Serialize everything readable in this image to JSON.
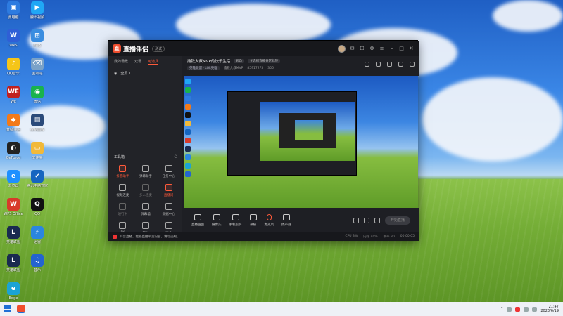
{
  "desktop": {
    "icons": [
      {
        "label": "此电脑",
        "glyph": "▣",
        "color": "#2d7be0"
      },
      {
        "label": "腾讯视频",
        "glyph": "▶",
        "color": "#20a7f5"
      },
      {
        "label": "WPS",
        "glyph": "W",
        "color": "#2f5fd6"
      },
      {
        "label": "网络",
        "glyph": "⊞",
        "color": "#3a8de0"
      },
      {
        "label": "QQ音乐",
        "glyph": "♪",
        "color": "#f5c518"
      },
      {
        "label": "回收站",
        "glyph": "⌫",
        "color": "#7aa2c8"
      },
      {
        "label": "WE",
        "glyph": "WE",
        "color": "#c02020"
      },
      {
        "label": "微信",
        "glyph": "◉",
        "color": "#19b34c"
      },
      {
        "label": "直播伴侣",
        "glyph": "◆",
        "color": "#f27a1a"
      },
      {
        "label": "控制面板",
        "glyph": "▤",
        "color": "#2a4a7a"
      },
      {
        "label": "GeForce",
        "glyph": "◐",
        "color": "#222"
      },
      {
        "label": "文件夹",
        "glyph": "▭",
        "color": "#f1b93a"
      },
      {
        "label": "浏览器",
        "glyph": "e",
        "color": "#1e90ff"
      },
      {
        "label": "腾讯电脑管家",
        "glyph": "✔",
        "color": "#1565c0"
      },
      {
        "label": "WPS Office",
        "glyph": "W",
        "color": "#d83a2a"
      },
      {
        "label": "QQ",
        "glyph": "Q",
        "color": "#111"
      },
      {
        "label": "英雄联盟",
        "glyph": "L",
        "color": "#1a2b50"
      },
      {
        "label": "迅雷",
        "glyph": "⚡",
        "color": "#2b86e0"
      },
      {
        "label": "英雄联盟",
        "glyph": "L",
        "color": "#1a2b50"
      },
      {
        "label": "音乐",
        "glyph": "♫",
        "color": "#2464d0"
      },
      {
        "label": "Edge",
        "glyph": "e",
        "color": "#1ba3d5"
      }
    ]
  },
  "app": {
    "title": "直播伴侣",
    "version": "测试",
    "left_tabs": [
      "我的场景",
      "双场",
      "可道具"
    ],
    "scene_label": "全屏 1",
    "toolbox_label": "工具箱",
    "tools": [
      {
        "label": "抖音助手",
        "state": "hot"
      },
      {
        "label": "弹幕助手",
        "state": ""
      },
      {
        "label": "任务中心",
        "state": ""
      },
      {
        "label": "视频连麦",
        "state": ""
      },
      {
        "label": "多人连麦",
        "state": "dim"
      },
      {
        "label": "直播间",
        "state": "hot"
      },
      {
        "label": "进行中",
        "state": "dim"
      },
      {
        "label": "弹幕墙",
        "state": ""
      },
      {
        "label": "数据中心",
        "state": ""
      },
      {
        "label": "PK",
        "state": ""
      },
      {
        "label": "互动",
        "state": ""
      },
      {
        "label": "更多",
        "state": ""
      }
    ],
    "room": {
      "title": "撸铁大叔MVP的快乐生活",
      "edit_tag": "修改",
      "notice_tag": "#选择直播分区标签",
      "category_tag": "英雄联盟 · LOL英雄",
      "uid_label": "撸铁大叔MVP",
      "uid": "85917275",
      "fans": "356"
    },
    "controls": [
      {
        "label": "直播画面"
      },
      {
        "label": "摄像头"
      },
      {
        "label": "手机投屏"
      },
      {
        "label": "录播"
      },
      {
        "label": "麦克风",
        "kind": "mic"
      },
      {
        "label": "扬声器"
      }
    ],
    "start_button": "开始直播",
    "status_text": "抖音直播，能够直播带货内容，请勿违规。",
    "status_right": [
      "CPU 3%",
      "内存 40%",
      "帧率 30",
      "00:00:05"
    ]
  },
  "taskbar": {
    "time": "21:47",
    "date": "2023/6/19"
  }
}
